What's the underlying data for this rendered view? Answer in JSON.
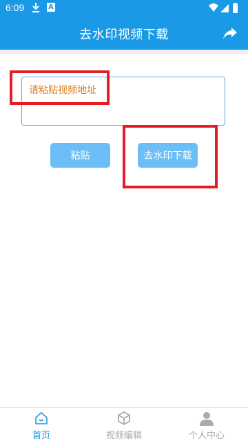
{
  "status_bar": {
    "time": "6:09",
    "notification_icons": [
      "download-icon",
      "a-icon"
    ],
    "system_icons": [
      "wifi-icon",
      "signal-icon",
      "battery-icon"
    ],
    "a_icon_letter": "A"
  },
  "app_bar": {
    "title": "去水印视频下载",
    "action_icon": "share-icon"
  },
  "url_input": {
    "placeholder": "请粘贴视频地址",
    "value": ""
  },
  "buttons": {
    "paste_label": "粘贴",
    "download_label": "去水印下载"
  },
  "bottom_nav": {
    "items": [
      {
        "label": "首页",
        "icon": "home-icon",
        "active": true
      },
      {
        "label": "视频编辑",
        "icon": "cube-icon",
        "active": false
      },
      {
        "label": "个人中心",
        "icon": "person-icon",
        "active": false
      }
    ]
  },
  "colors": {
    "primary": "#1a9ae6",
    "button": "#6cbef7",
    "placeholder": "#e07b1a",
    "annotation": "#e51c23",
    "nav_inactive": "#aaaaaa"
  }
}
